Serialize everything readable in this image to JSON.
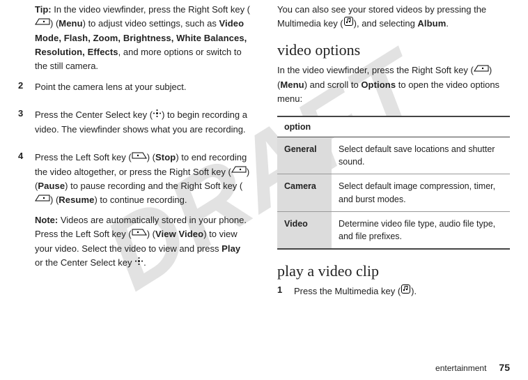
{
  "watermark": "DRAFT",
  "left": {
    "tip": {
      "label": "Tip:",
      "pre": " In the video viewfinder, press the Right Soft key (",
      "mid1": ") (",
      "menu": "Menu",
      "mid2": ") to adjust video settings, such as ",
      "opts": "Video Mode, Flash, Zoom, Brightness, White Balances, Resolution, Effects",
      "post": ", and more options or switch to the still camera."
    },
    "step2": {
      "num": "2",
      "text": "Point the camera lens at your subject."
    },
    "step3": {
      "num": "3",
      "pre": "Press the Center Select key (",
      "post": ") to begin recording a video. The viewfinder shows what you are recording."
    },
    "step4": {
      "num": "4",
      "p1_a": "Press the Left Soft key (",
      "p1_b": ") (",
      "stop": "Stop",
      "p1_c": ") to end recording the video altogether, or press the Right Soft key (",
      "p1_d": ") (",
      "pause": "Pause",
      "p1_e": ") to pause recording and the Right Soft key (",
      "p1_f": ") (",
      "resume": "Resume",
      "p1_g": ") to continue recording.",
      "note_label": "Note:",
      "n_a": " Videos are automatically stored in your phone. Press the Left Soft key (",
      "n_b": ") (",
      "viewvideo": "View Video",
      "n_c": ") to view your video. Select the video to view and press ",
      "play": "Play",
      "n_d": " or the Center Select key ",
      "n_e": "."
    }
  },
  "right": {
    "top": {
      "a": "You can also see your stored videos by pressing the Multimedia key (",
      "b": "), and selecting ",
      "album": "Album",
      "c": "."
    },
    "h_video_options": "video options",
    "vo_para": {
      "a": "In the video viewfinder, press the Right Soft key (",
      "b": ") (",
      "menu": "Menu",
      "c": ") and scroll to ",
      "options": "Options",
      "d": " to open the video options menu:"
    },
    "table": {
      "header": "option",
      "rows": [
        {
          "label": "General",
          "desc": "Select default save locations and shutter sound."
        },
        {
          "label": "Camera",
          "desc": "Select default image compression, timer, and burst modes."
        },
        {
          "label": "Video",
          "desc": "Determine video file type, audio file type, and file prefixes."
        }
      ]
    },
    "h_play": "play a video clip",
    "play_step1": {
      "num": "1",
      "a": "Press the Multimedia key (",
      "b": ")."
    }
  },
  "footer": {
    "section": "entertainment",
    "page": "75"
  }
}
